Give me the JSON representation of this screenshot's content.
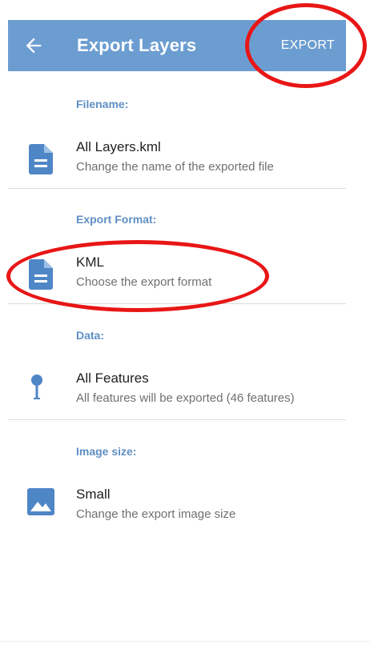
{
  "appbar": {
    "title": "Export Layers",
    "action_label": "EXPORT",
    "back_icon": "arrow-back-icon",
    "color": "#6c9dd1"
  },
  "sections": [
    {
      "label": "Filename:",
      "primary": "All Layers.kml",
      "secondary": "Change the name of the exported file",
      "icon": "document-icon"
    },
    {
      "label": "Export Format:",
      "primary": "KML",
      "secondary": "Choose the export format",
      "icon": "document-icon"
    },
    {
      "label": "Data:",
      "primary": "All Features",
      "secondary": "All features will be exported (46 features)",
      "icon": "map-pin-icon"
    },
    {
      "label": "Image size:",
      "primary": "Small",
      "secondary": "Change the export image size",
      "icon": "image-icon"
    }
  ],
  "colors": {
    "accent": "#6c9dd1",
    "section_label": "#5f8fc4",
    "annotation": "#e81616"
  }
}
